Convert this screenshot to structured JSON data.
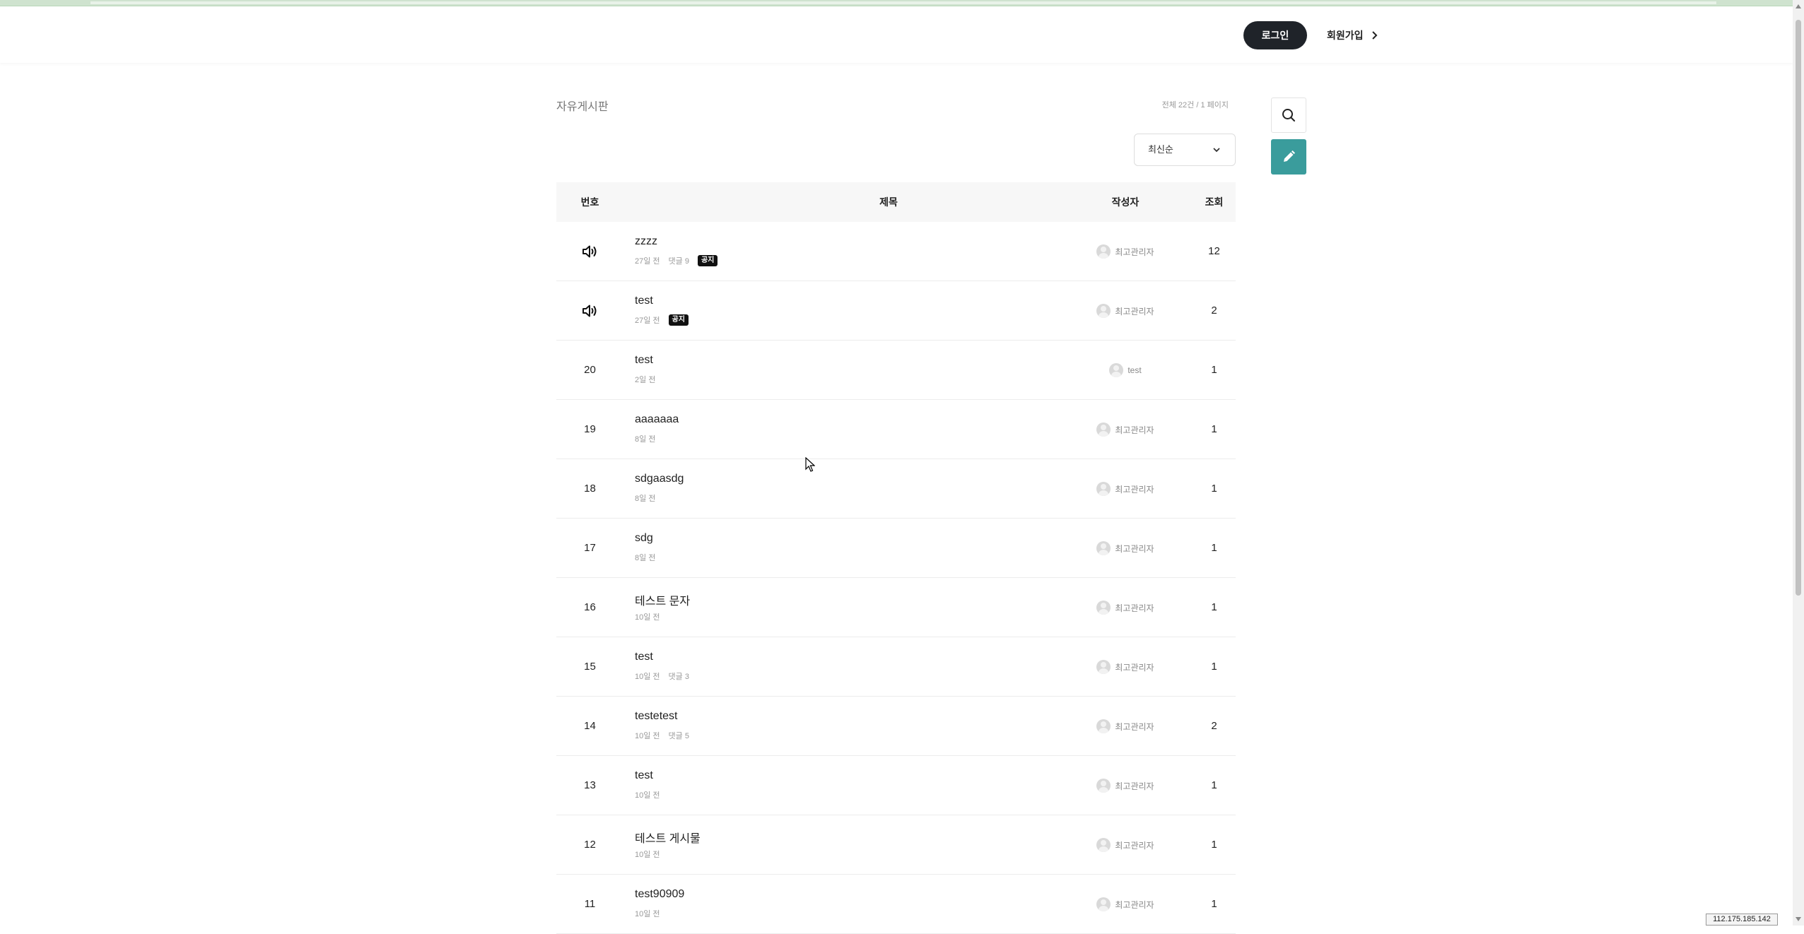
{
  "header": {
    "login_label": "로그인",
    "signup_label": "회원가입"
  },
  "board": {
    "title": "자유게시판",
    "count_text": "전체 22건 / 1 페이지",
    "sort_selected": "최신순"
  },
  "table": {
    "columns": {
      "num": "번호",
      "title": "제목",
      "author": "작성자",
      "views": "조회"
    },
    "rows": [
      {
        "num": "",
        "notice": true,
        "title": "zzzz",
        "date": "27일 전",
        "comments": "댓글 9",
        "badge": "공지",
        "author": "최고관리자",
        "views": "12"
      },
      {
        "num": "",
        "notice": true,
        "title": "test",
        "date": "27일 전",
        "comments": "",
        "badge": "공지",
        "author": "최고관리자",
        "views": "2"
      },
      {
        "num": "20",
        "notice": false,
        "title": "test",
        "date": "2일 전",
        "comments": "",
        "badge": "",
        "author": "test",
        "views": "1"
      },
      {
        "num": "19",
        "notice": false,
        "title": "aaaaaaa",
        "date": "8일 전",
        "comments": "",
        "badge": "",
        "author": "최고관리자",
        "views": "1"
      },
      {
        "num": "18",
        "notice": false,
        "title": "sdgaasdg",
        "date": "8일 전",
        "comments": "",
        "badge": "",
        "author": "최고관리자",
        "views": "1"
      },
      {
        "num": "17",
        "notice": false,
        "title": "sdg",
        "date": "8일 전",
        "comments": "",
        "badge": "",
        "author": "최고관리자",
        "views": "1"
      },
      {
        "num": "16",
        "notice": false,
        "title": "테스트 문자",
        "date": "10일 전",
        "comments": "",
        "badge": "",
        "author": "최고관리자",
        "views": "1"
      },
      {
        "num": "15",
        "notice": false,
        "title": "test",
        "date": "10일 전",
        "comments": "댓글 3",
        "badge": "",
        "author": "최고관리자",
        "views": "1"
      },
      {
        "num": "14",
        "notice": false,
        "title": "testetest",
        "date": "10일 전",
        "comments": "댓글 5",
        "badge": "",
        "author": "최고관리자",
        "views": "2"
      },
      {
        "num": "13",
        "notice": false,
        "title": "test",
        "date": "10일 전",
        "comments": "",
        "badge": "",
        "author": "최고관리자",
        "views": "1"
      },
      {
        "num": "12",
        "notice": false,
        "title": "테스트 게시물",
        "date": "10일 전",
        "comments": "",
        "badge": "",
        "author": "최고관리자",
        "views": "1"
      },
      {
        "num": "11",
        "notice": false,
        "title": "test90909",
        "date": "10일 전",
        "comments": "",
        "badge": "",
        "author": "최고관리자",
        "views": "1"
      }
    ]
  },
  "status": {
    "ip": "112.175.185.142"
  },
  "icons": {
    "search": "search-icon",
    "write": "pencil-icon",
    "notice": "speaker-icon",
    "sort": "chevron-down-icon",
    "signup": "chevron-right-icon"
  },
  "colors": {
    "login_bg": "#1f2329",
    "write_btn": "#3a9c9c"
  }
}
